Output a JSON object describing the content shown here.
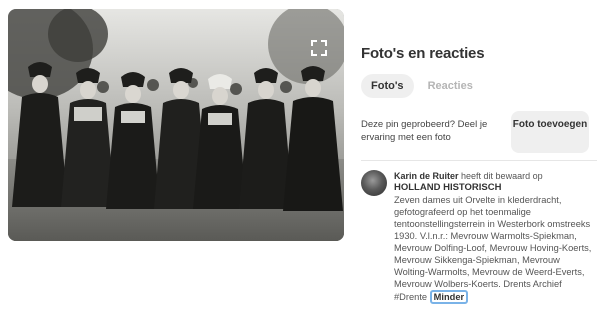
{
  "panel": {
    "title": "Foto's en reacties",
    "tabs": [
      {
        "label": "Foto's",
        "active": true
      },
      {
        "label": "Reacties",
        "active": false
      }
    ],
    "prompt_text": "Deze pin geprobeerd? Deel je ervaring met een foto",
    "add_photo_label": "Foto toevoegen"
  },
  "pin": {
    "author": "Karin de Ruiter",
    "saved_text": "heeft dit bewaard op",
    "board": "HOLLAND HISTORISCH",
    "description": "Zeven dames uit Orvelte in klederdracht, gefotografeerd op het toenmalige tentoonstellingsterrein in Westerbork omstreeks 1930. V.l.n.r.: Mevrouw Warmolts-Spiekman, Mevrouw Dolfing-Loof, Mevrouw Hoving-Koerts, Mevrouw Sikkenga-Spiekman, Mevrouw Wolting-Warmolts, Mevrouw de Weerd-Everts, Mevrouw Wolbers-Koerts. Drents Archief #Drente",
    "less_label": "Minder"
  },
  "icons": {
    "expand": "expand-icon"
  },
  "colors": {
    "focus_outline": "#7ab3e8",
    "tab_active_bg": "#efefef",
    "tab_inactive_text": "#b5b5b5"
  }
}
